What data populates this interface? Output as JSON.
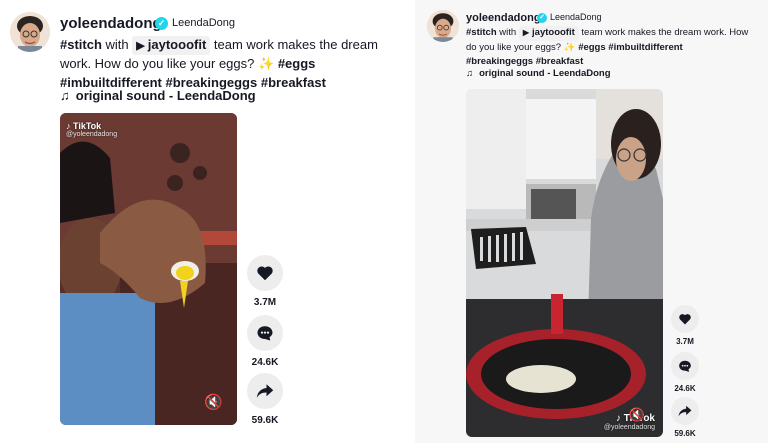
{
  "left": {
    "username": "yoleendadong",
    "nickname": "LeendaDong",
    "caption": {
      "prefix": "#stitch",
      "with_word": "with",
      "mention": "jaytooofit",
      "body": "team work makes the dream work. How do you like your eggs?",
      "sparkle": "✨",
      "hashtags": [
        "#eggs",
        "#imbuiltdifferent",
        "#breakingeggs",
        "#breakfast"
      ]
    },
    "sound": "original sound - LeendaDong",
    "watermark": {
      "brand": "TikTok",
      "handle": "@yoleendadong"
    },
    "actions": {
      "likes": "3.7M",
      "comments": "24.6K",
      "shares": "59.6K"
    }
  },
  "right": {
    "username": "yoleendadong",
    "nickname": "LeendaDong",
    "caption": {
      "prefix": "#stitch",
      "with_word": "with",
      "mention": "jaytooofit",
      "body": "team work makes the dream work. How do you like your eggs?",
      "sparkle": "✨",
      "hashtags": [
        "#eggs",
        "#imbuiltdifferent",
        "#breakingeggs",
        "#breakfast"
      ]
    },
    "sound": "original sound - LeendaDong",
    "watermark": {
      "brand": "TikTok",
      "handle": "@yoleendadong"
    },
    "actions": {
      "likes": "3.7M",
      "comments": "24.6K",
      "shares": "59.6K"
    }
  },
  "colors": {
    "verified": "#20d5ec",
    "text": "#161823",
    "action_bg": "#ededee"
  },
  "icons": [
    "verified-badge-icon",
    "play-icon",
    "music-note-icon",
    "heart-icon",
    "comment-icon",
    "share-icon",
    "mute-icon",
    "tiktok-logo-icon"
  ]
}
